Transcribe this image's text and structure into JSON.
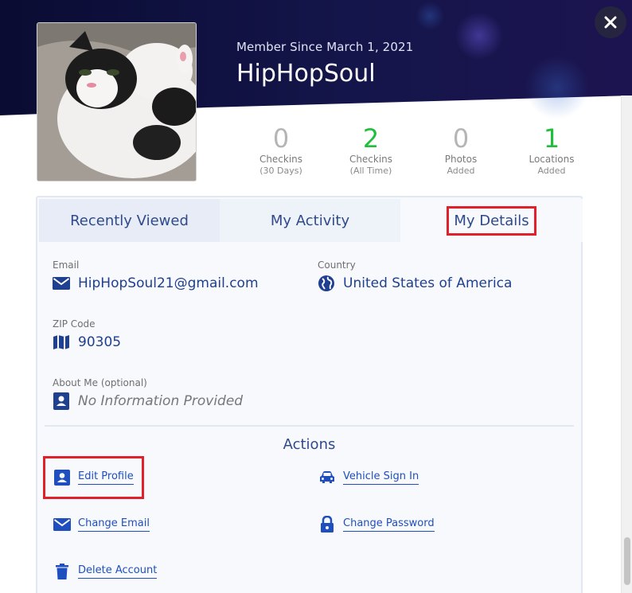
{
  "profile": {
    "member_since": "Member Since March 1, 2021",
    "username": "HipHopSoul",
    "avatar_desc": "cat-photo"
  },
  "stats": [
    {
      "value": "0",
      "label": "Checkins",
      "sub": "(30 Days)",
      "color": "#b5b5b5"
    },
    {
      "value": "2",
      "label": "Checkins",
      "sub": "(All Time)",
      "color": "#1fbf3a"
    },
    {
      "value": "0",
      "label": "Photos",
      "sub": "Added",
      "color": "#b5b5b5"
    },
    {
      "value": "1",
      "label": "Locations",
      "sub": "Added",
      "color": "#1fbf3a"
    }
  ],
  "tabs": [
    {
      "label": "Recently Viewed"
    },
    {
      "label": "My Activity"
    },
    {
      "label": "My Details",
      "active": true
    }
  ],
  "details": {
    "email_label": "Email",
    "email_value": "HipHopSoul21@gmail.com",
    "country_label": "Country",
    "country_value": "United States of America",
    "zip_label": "ZIP Code",
    "zip_value": "90305",
    "about_label": "About Me (optional)",
    "about_value": "No Information Provided"
  },
  "actions": {
    "title": "Actions",
    "edit_profile": "Edit Profile",
    "vehicle_sign_in": "Vehicle Sign In",
    "change_email": "Change Email",
    "change_password": "Change Password",
    "delete_account": "Delete Account"
  },
  "colors": {
    "hero_dark": "#0d0f3a",
    "accent_blue": "#1f3f8f",
    "link_blue": "#1f4fbf",
    "green": "#1fbf3a",
    "highlight_red": "#e0202a"
  }
}
